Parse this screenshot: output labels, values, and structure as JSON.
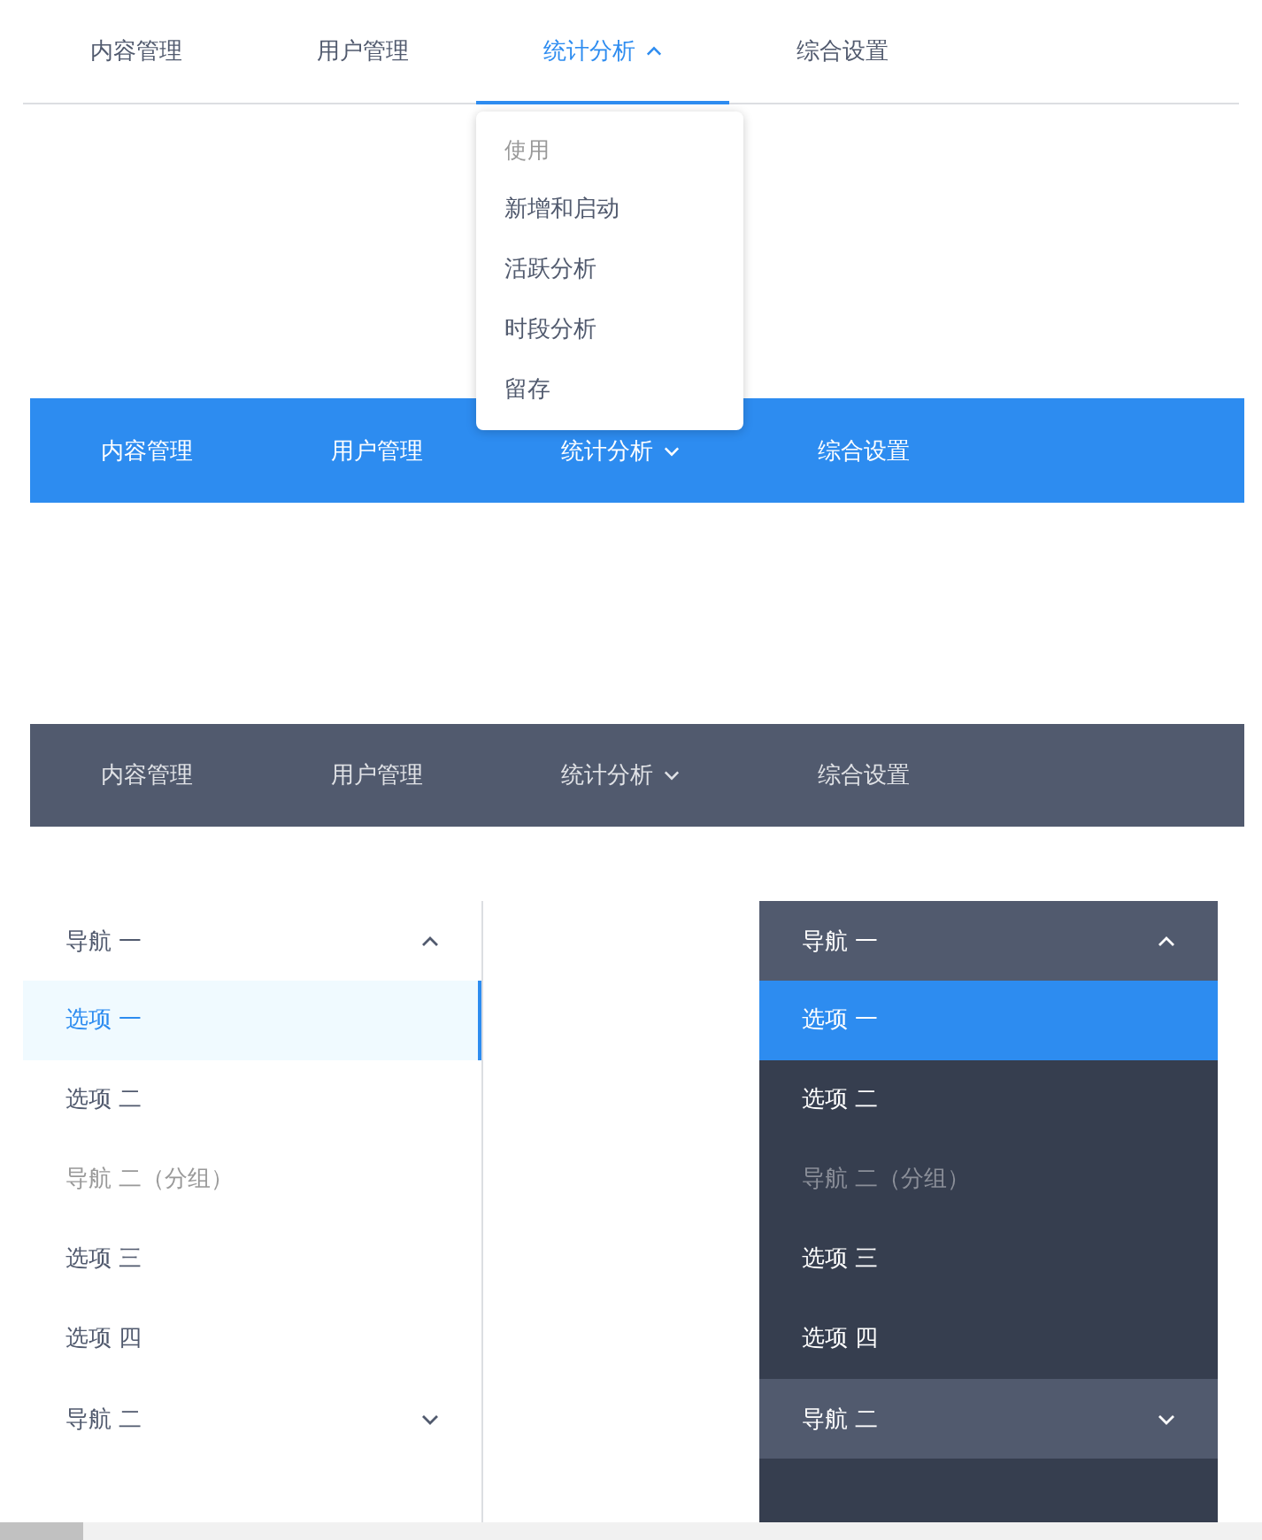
{
  "top_menus": [
    {
      "kind": "light",
      "items": [
        {
          "label": "内容管理",
          "selected": false
        },
        {
          "label": "用户管理",
          "selected": false
        },
        {
          "label": "统计分析",
          "selected": true,
          "expanded": true,
          "children": [
            {
              "kind": "group",
              "label": "使用"
            },
            {
              "kind": "option",
              "label": "新增和启动"
            },
            {
              "kind": "option",
              "label": "活跃分析"
            },
            {
              "kind": "option",
              "label": "时段分析"
            },
            {
              "kind": "option",
              "label": "留存"
            }
          ]
        },
        {
          "label": "综合设置",
          "selected": false
        }
      ]
    },
    {
      "kind": "primary",
      "items": [
        {
          "label": "内容管理",
          "selected": false
        },
        {
          "label": "用户管理",
          "selected": false
        },
        {
          "label": "统计分析",
          "selected": false,
          "expanded": false
        },
        {
          "label": "综合设置",
          "selected": false
        }
      ]
    },
    {
      "kind": "dark",
      "items": [
        {
          "label": "内容管理",
          "selected": false
        },
        {
          "label": "用户管理",
          "selected": false
        },
        {
          "label": "统计分析",
          "selected": false,
          "expanded": false
        },
        {
          "label": "综合设置",
          "selected": false
        }
      ]
    }
  ],
  "side_menus": [
    {
      "kind": "light",
      "items": [
        {
          "kind": "submenu",
          "label": "导航 一",
          "expanded": true,
          "children": [
            {
              "kind": "option",
              "label": "选项 一",
              "selected": true
            },
            {
              "kind": "option",
              "label": "选项 二",
              "selected": false
            },
            {
              "kind": "group",
              "label": "导航 二（分组）"
            },
            {
              "kind": "option",
              "label": "选项 三",
              "selected": false
            },
            {
              "kind": "option",
              "label": "选项 四",
              "selected": false
            }
          ]
        },
        {
          "kind": "submenu",
          "label": "导航 二",
          "expanded": false
        }
      ]
    },
    {
      "kind": "dark",
      "items": [
        {
          "kind": "submenu",
          "label": "导航 一",
          "expanded": true,
          "children": [
            {
              "kind": "option",
              "label": "选项 一",
              "selected": true
            },
            {
              "kind": "option",
              "label": "选项 二",
              "selected": false
            },
            {
              "kind": "group",
              "label": "导航 二（分组）"
            },
            {
              "kind": "option",
              "label": "选项 三",
              "selected": false
            },
            {
              "kind": "option",
              "label": "选项 四",
              "selected": false
            }
          ]
        },
        {
          "kind": "submenu",
          "label": "导航 二",
          "expanded": false
        }
      ]
    }
  ]
}
